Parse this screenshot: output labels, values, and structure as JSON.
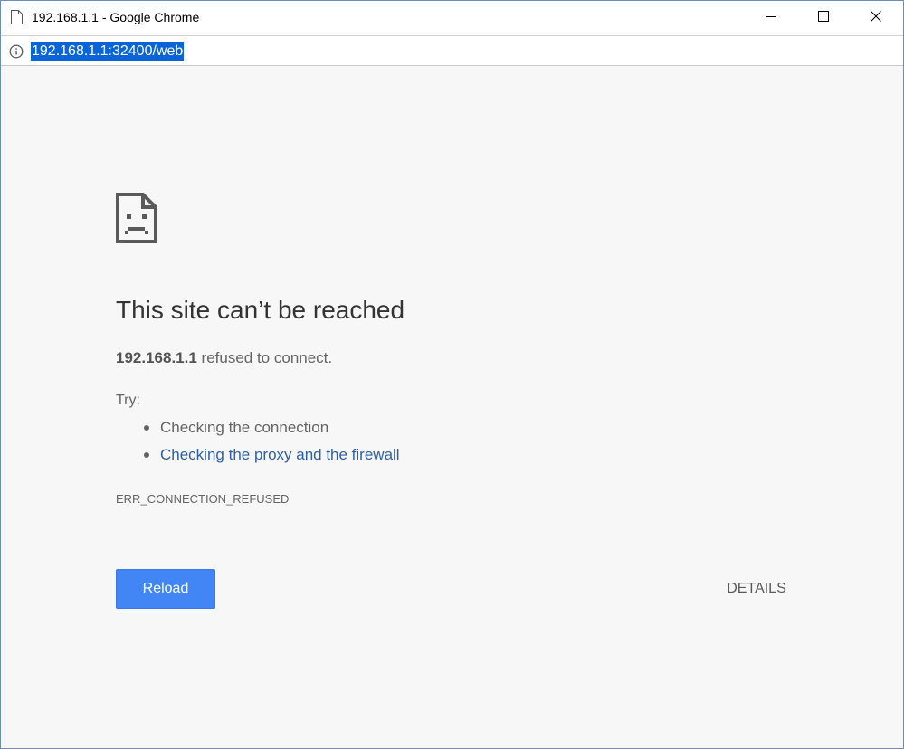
{
  "window": {
    "title": "192.168.1.1 - Google Chrome",
    "page_icon": "page-icon",
    "controls": [
      "minimize-icon",
      "maximize-icon",
      "close-icon"
    ]
  },
  "addressbar": {
    "info_icon": "info-icon",
    "url": "192.168.1.1:32400/web"
  },
  "error_page": {
    "icon": "sad-document-icon",
    "heading": "This site can’t be reached",
    "host": "192.168.1.1",
    "message_suffix": " refused to connect.",
    "try_label": "Try:",
    "suggestions": [
      {
        "label": "Checking the connection",
        "link": false
      },
      {
        "label": "Checking the proxy and the firewall",
        "link": true
      }
    ],
    "error_code": "ERR_CONNECTION_REFUSED",
    "reload_label": "Reload",
    "details_label": "DETAILS"
  },
  "colors": {
    "accent": "#4285f4",
    "link": "#2f5fa3",
    "selection": "#0a64d8",
    "background": "#f7f7f7"
  }
}
